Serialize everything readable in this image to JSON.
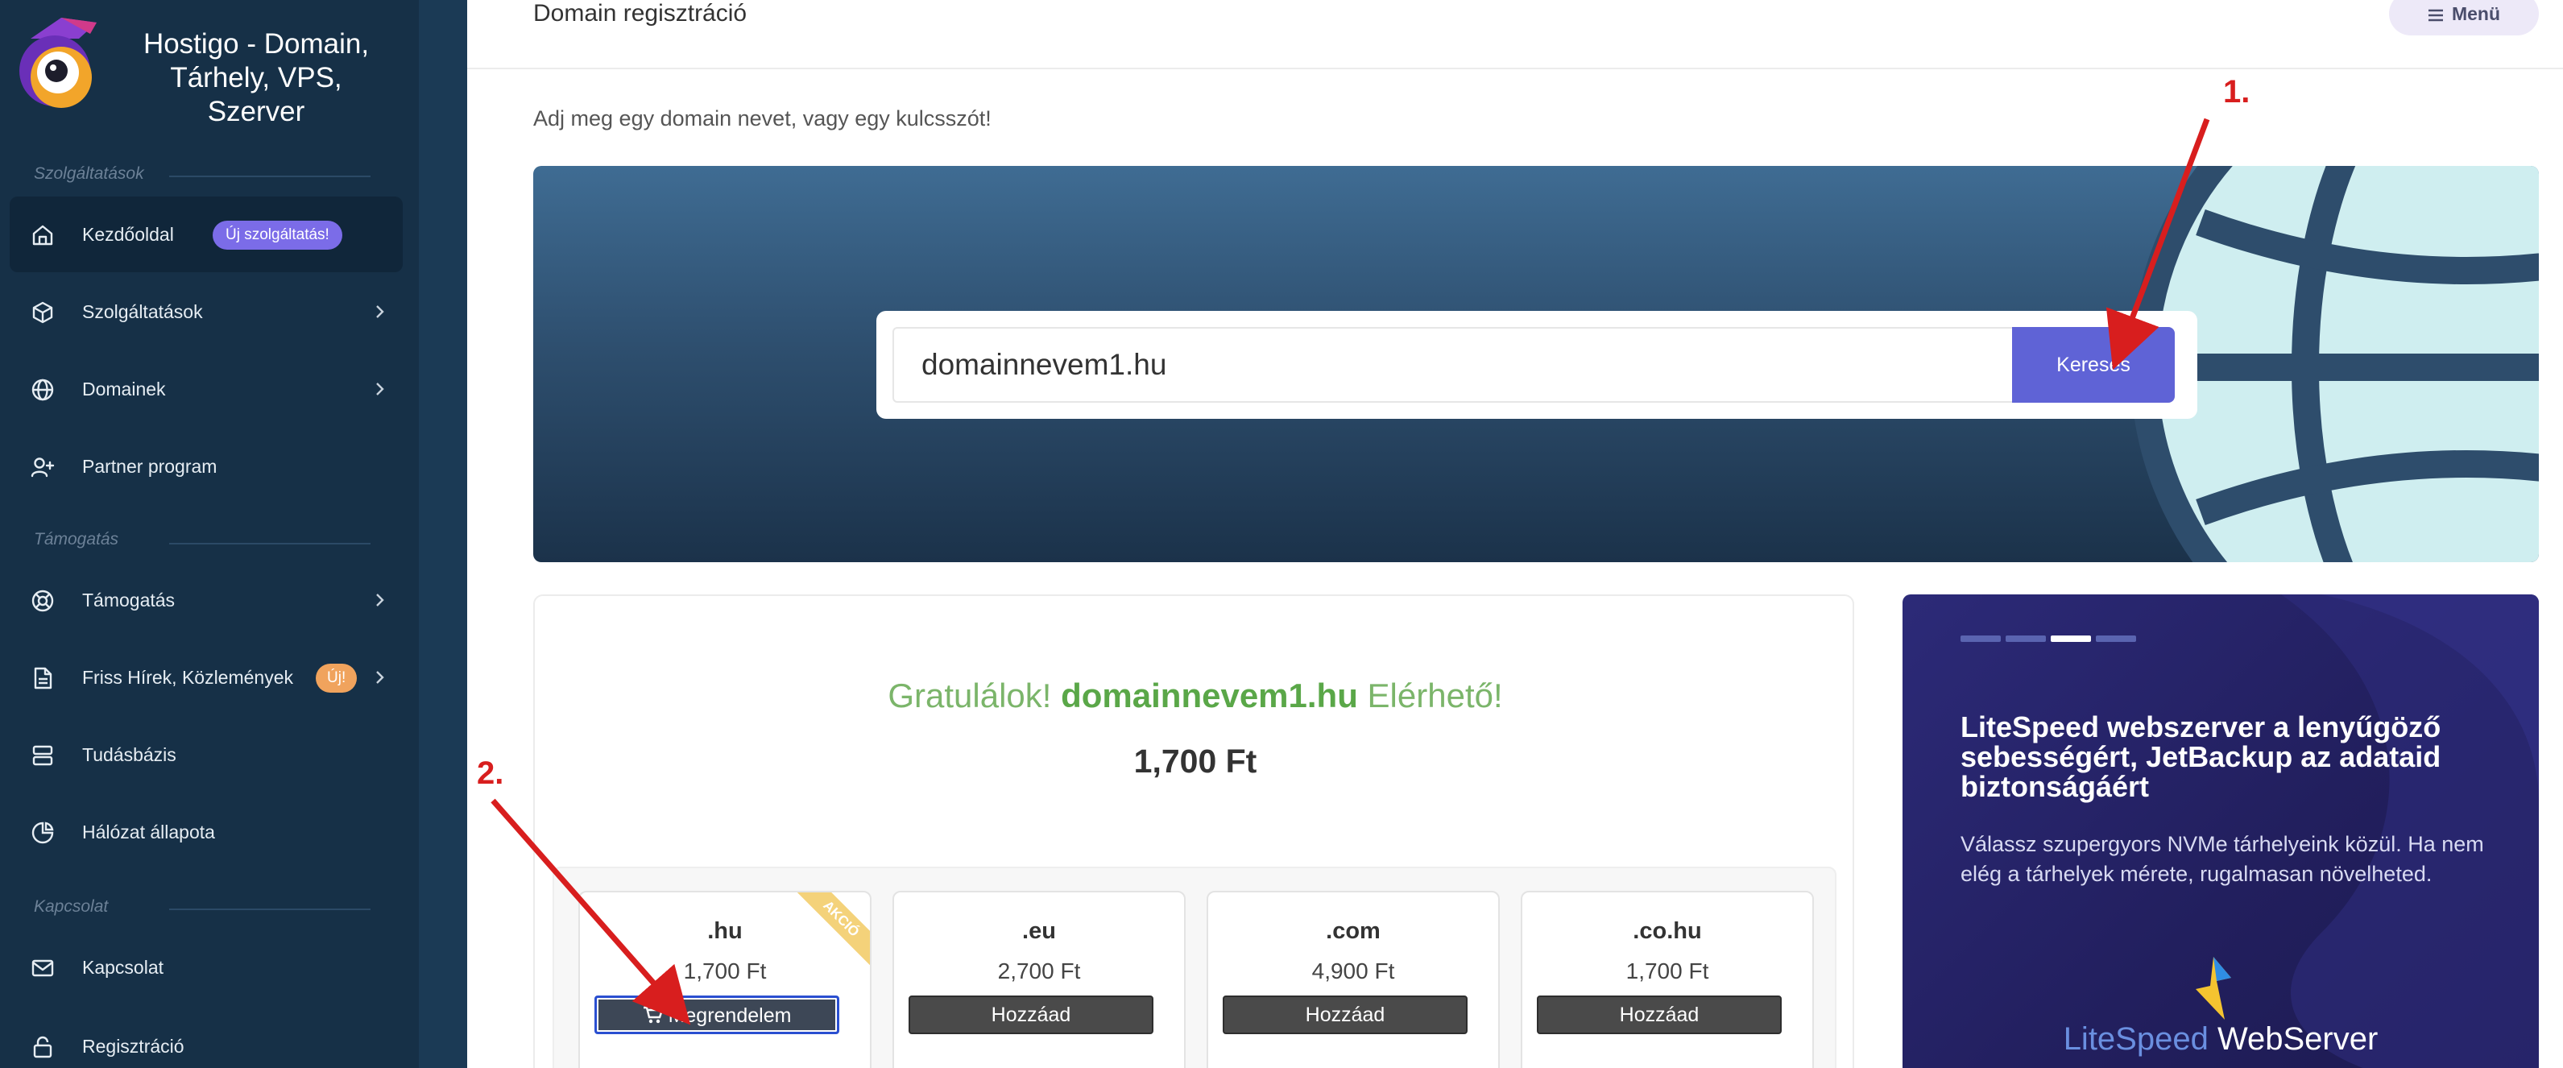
{
  "brand": {
    "name": "Hostigo - Domain, Tárhely, VPS, Szerver"
  },
  "sidebar": {
    "sections": [
      {
        "title": "Szolgáltatások"
      },
      {
        "title": "Támogatás"
      },
      {
        "title": "Kapcsolat"
      }
    ],
    "items": [
      {
        "label": "Kezdőoldal",
        "icon": "home-icon",
        "badge": "Új szolgáltatás!"
      },
      {
        "label": "Szolgáltatások",
        "icon": "box-icon"
      },
      {
        "label": "Domainek",
        "icon": "globe-icon"
      },
      {
        "label": "Partner program",
        "icon": "user-plus-icon"
      },
      {
        "label": "Támogatás",
        "icon": "lifebuoy-icon"
      },
      {
        "label": "Friss Hírek, Közlemények",
        "icon": "document-icon",
        "badge": "Új!"
      },
      {
        "label": "Tudásbázis",
        "icon": "database-icon"
      },
      {
        "label": "Hálózat állapota",
        "icon": "pie-chart-icon"
      },
      {
        "label": "Kapcsolat",
        "icon": "mail-icon"
      },
      {
        "label": "Regisztráció",
        "icon": "lock-icon"
      }
    ]
  },
  "header": {
    "title": "Domain regisztráció",
    "menu_label": "Menü"
  },
  "intro": "Adj meg egy domain nevet, vagy egy kulcsszót!",
  "search": {
    "value": "domainnevem1.hu",
    "button_label": "Keresés"
  },
  "result": {
    "prefix": "Gratulálok!",
    "domain": "domainnevem1.hu",
    "suffix": "Elérhető!",
    "price": "1,700 Ft"
  },
  "tlds": [
    {
      "name": ".hu",
      "price": "1,700 Ft",
      "button": "Megrendelem",
      "ribbon": "AKCIÓ"
    },
    {
      "name": ".eu",
      "price": "2,700 Ft",
      "button": "Hozzáad"
    },
    {
      "name": ".com",
      "price": "4,900 Ft",
      "button": "Hozzáad"
    },
    {
      "name": ".co.hu",
      "price": "1,700 Ft",
      "button": "Hozzáad"
    }
  ],
  "promo": {
    "title": "LiteSpeed webszerver a lenyűgöző sebességért, JetBackup az adataid biztonságáért",
    "text": "Válassz szupergyors NVMe tárhelyeink közül. Ha nem elég a tárhelyek mérete, rugalmasan növelheted.",
    "brand_lite": "LiteSpeed",
    "brand_web": "WebServer",
    "slides": 4,
    "active_slide": 3
  },
  "annotations": {
    "step1": "1.",
    "step2": "2."
  },
  "colors": {
    "sidebar": "#163047",
    "accent": "#5f63d6",
    "success": "#5aa748",
    "annotation": "#d81e1e"
  }
}
